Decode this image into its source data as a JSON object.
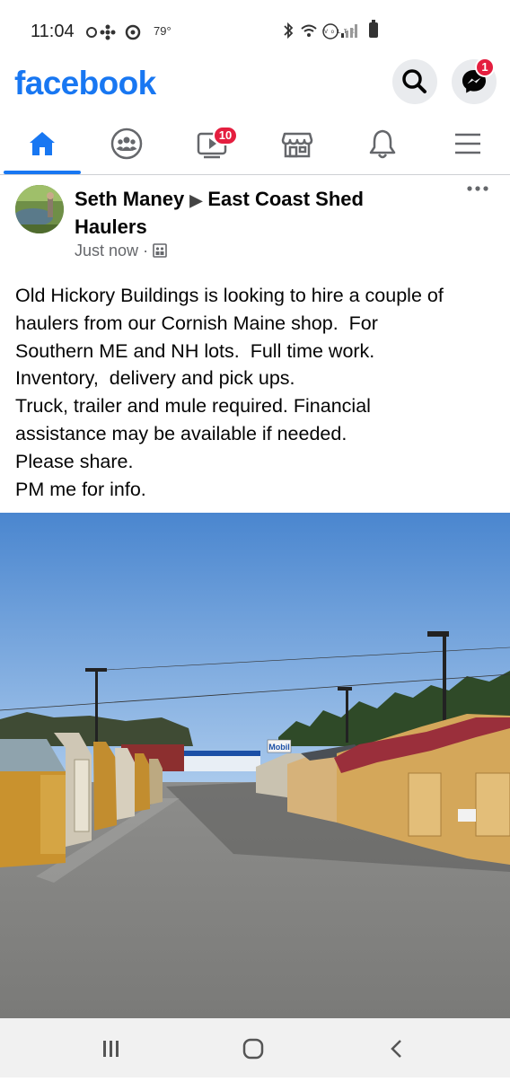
{
  "status_bar": {
    "time": "11:04",
    "temperature": "79°"
  },
  "app_bar": {
    "logo": "facebook",
    "search_icon": "search-icon",
    "messenger_icon": "messenger-icon",
    "messenger_badge": "1"
  },
  "nav": {
    "items": [
      {
        "name": "home",
        "icon": "home-icon",
        "active": true
      },
      {
        "name": "groups",
        "icon": "groups-icon"
      },
      {
        "name": "watch",
        "icon": "watch-icon",
        "badge": "10"
      },
      {
        "name": "marketplace",
        "icon": "marketplace-icon"
      },
      {
        "name": "notifications",
        "icon": "bell-icon"
      },
      {
        "name": "menu",
        "icon": "menu-icon"
      }
    ],
    "accent": "#1877f2",
    "badge_color": "#e41e3f"
  },
  "post": {
    "author": "Seth Maney",
    "group": "East Coast Shed Haulers",
    "timestamp": "Just now",
    "body_lines": [
      "Old Hickory Buildings is looking to hire a couple of",
      "haulers from our Cornish Maine shop.  For",
      "Southern ME and NH lots.  Full time work.",
      "Inventory,  delivery and pick ups.",
      "Truck, trailer and mule required. Financial",
      "assistance may be available if needed.",
      "Please share.",
      "PM me for info."
    ],
    "image_sign": "Mobil"
  }
}
